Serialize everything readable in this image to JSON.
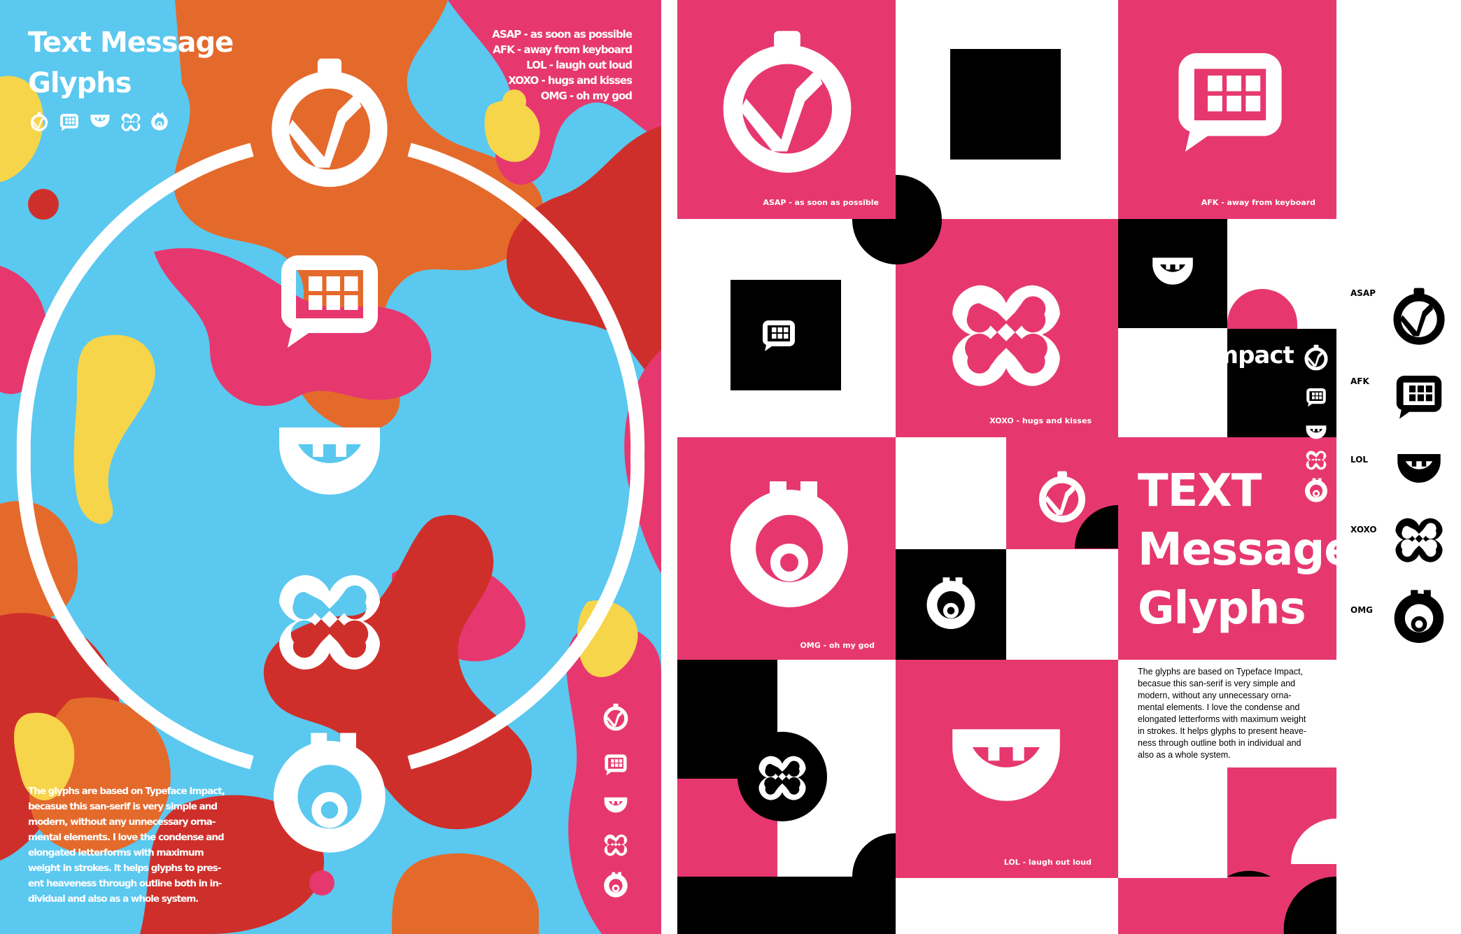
{
  "colors": {
    "cyan": "#5bc8ef",
    "pink": "#e6386f",
    "orange": "#e46a2c",
    "red": "#cf2f2a",
    "yellow": "#f7d54a",
    "black": "#000000",
    "white": "#ffffff"
  },
  "left_poster": {
    "title_line1": "Text Message",
    "title_line2": "Glyphs",
    "abbreviations": [
      "ASAP - as soon as possible",
      "AFK - away from keyboard",
      "LOL - laugh out loud",
      "XOXO - hugs and kisses",
      "OMG - oh my god"
    ],
    "description": "The glyphs are based on Typeface Impact, becasue this san-serif is very simple and modern, without any unnecessary ornamental elements. I love the condense and elongated letterforms with maximum weight in strokes. It helps glyphs to present heaveness through outline both in individual and also as a whole system.",
    "desc_lines": [
      "The glyphs are based on Typeface Impact,",
      "becasue this san-serif is very simple and",
      "modern, without any unnecessary orna-",
      "mental elements. I love the condense and",
      "elongated letterforms with maximum",
      "weight in strokes. It helps glyphs to pres-",
      "ent heaveness through outline both in in-",
      "dividual and also as a whole system."
    ],
    "glyph_icons": [
      "asap-glyph-icon",
      "afk-glyph-icon",
      "lol-glyph-icon",
      "xoxo-glyph-icon",
      "omg-glyph-icon"
    ]
  },
  "right_poster": {
    "tile_labels": {
      "asap": "ASAP - as soon as possible",
      "afk": "AFK - away from keyboard",
      "xoxo": "XOXO - hugs and kisses",
      "omg": "OMG - oh my god",
      "lol": "LOL - laugh out loud"
    },
    "impact_label": "Impact",
    "title_line1": "TEXT",
    "title_line2": "Message",
    "title_line3": "Glyphs",
    "desc_lines": [
      "The glyphs are based on Typeface Impact,",
      "becasue this san-serif is very simple and",
      "modern, without any unnecessary orna-",
      "mental elements. I love the condense and",
      "elongated letterforms with maximum weight",
      "in strokes. It helps glyphs to present heave-",
      "ness through outline both in individual and",
      "also as a whole system."
    ],
    "legend": [
      {
        "label": "ASAP",
        "icon": "asap-glyph-icon"
      },
      {
        "label": "AFK",
        "icon": "afk-glyph-icon"
      },
      {
        "label": "LOL",
        "icon": "lol-glyph-icon"
      },
      {
        "label": "XOXO",
        "icon": "xoxo-glyph-icon"
      },
      {
        "label": "OMG",
        "icon": "omg-glyph-icon"
      }
    ]
  }
}
